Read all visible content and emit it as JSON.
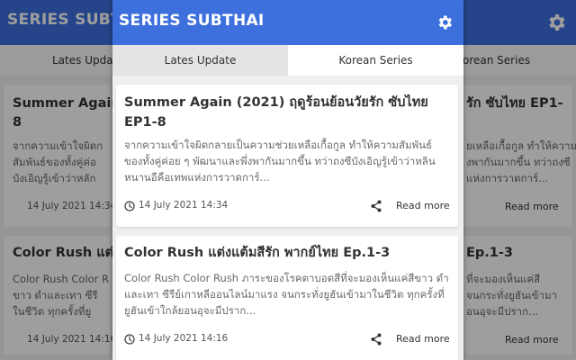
{
  "app": {
    "title": "SERIES SUBTHAI",
    "background_title": "SERIES SUBTH",
    "accent_color": "#3d6fdd"
  },
  "tabs": [
    {
      "label": "Lates Update",
      "active": true
    },
    {
      "label": "Korean Series",
      "active": false
    }
  ],
  "background": {
    "tab1": "Lates Updat",
    "tab2": "orean Series",
    "cards": [
      {
        "left_title_1": "Summer Again (",
        "left_title_2": "8",
        "left_body_1": "จากความเข้าใจผิดก",
        "left_body_2": "สัมพันธ์ของทั้งคู่ค่อ",
        "left_body_3": "บังเอิญรู้เข้าว่าหลัก",
        "left_date": "14 July 2021 14:34",
        "right_title": "รัก ซับไทย EP1-",
        "right_body_1": "ยเหลือเกื้อกูล ทำให้ความ",
        "right_body_2": "งพากันมากขึ้น ทว่าถงซี",
        "right_body_3": "แห่งการวาดการ์...",
        "right_readmore": "Read more"
      },
      {
        "left_title_1": "Color Rush แต่ง",
        "left_body_1": "Color Rush Color R",
        "left_body_2": "ขาว ดำและเทา ซีรี",
        "left_body_3": "ในชีวิต ทุกครั้งที่ยู",
        "left_date": "14 July 2021 14:16",
        "right_title": "Ep.1-3",
        "right_body_1": "ที่จะมองเห็นแค่สี",
        "right_body_2": "จนกระทั่งยูฮันเข้ามา",
        "right_body_3": "อนอุจะมีปราก...",
        "right_readmore": "Read more"
      }
    ]
  },
  "posts": [
    {
      "title": "Summer Again (2021) ฤดูร้อนย้อนวัยรัก ซับไทย EP1-8",
      "excerpt": "จากความเข้าใจผิดกลายเป็นความช่วยเหลือเกื้อกูล ทำให้ความสัมพันธ์ของทั้งคู่ค่อย ๆ พัฒนาและพึ่งพากันมากขึ้น ทว่าถงซีบังเอิญรู้เข้าว่าหลินหนานอีคือเทพแห่งการวาดการ์...",
      "date": "14 July 2021 14:34",
      "read_more": "Read more"
    },
    {
      "title": "Color Rush แต่งแต้มสีรัก พากย์ไทย Ep.1-3",
      "excerpt": "Color Rush Color Rush ภาระของโรคตาบอดสีที่จะมองเห็นแค่สีขาว ดำและเทา ซีรีย์เกาหลีออนไลน์มาแรง จนกระทั่งยูฮันเข้ามาในชีวิต ทุกครั้งที่ยูฮันเข้าใกล้ยอนอุจะมีปราก...",
      "date": "14 July 2021 14:16",
      "read_more": "Read more"
    }
  ],
  "icons": {
    "settings": "gear-icon",
    "share": "share-icon",
    "clock": "clock-icon"
  }
}
